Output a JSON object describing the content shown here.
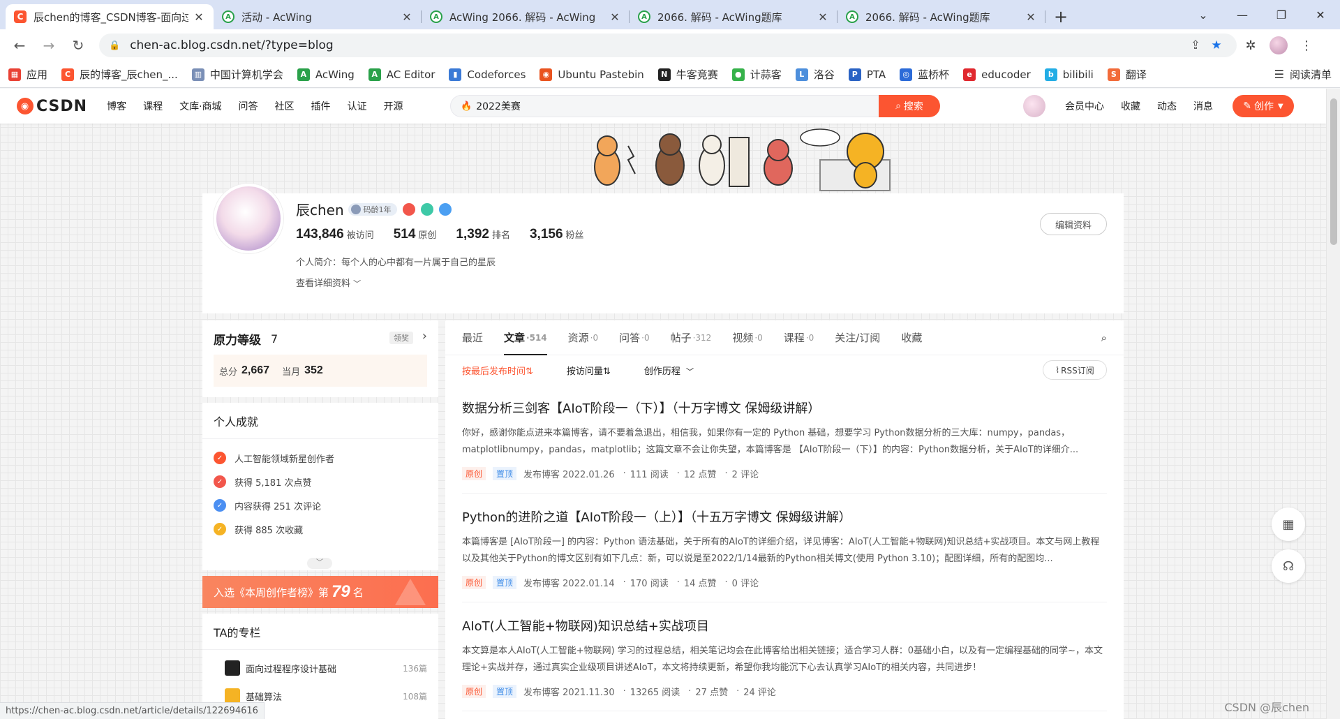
{
  "browser": {
    "tabs": [
      {
        "title": "辰chen的博客_CSDN博客-面向过程",
        "icon": "C",
        "active": true
      },
      {
        "title": "活动 - AcWing",
        "icon": "A",
        "active": false
      },
      {
        "title": "AcWing 2066. 解码 - AcWing",
        "icon": "A",
        "active": false
      },
      {
        "title": "2066. 解码 - AcWing题库",
        "icon": "A",
        "active": false
      },
      {
        "title": "2066. 解码 - AcWing题库",
        "icon": "A",
        "active": false
      }
    ],
    "url": "chen-ac.blog.csdn.net/?type=blog",
    "bookmarks": [
      {
        "label": "应用",
        "color": "#e94235",
        "glyph": "▦"
      },
      {
        "label": "辰的博客_辰chen_...",
        "color": "#fc5531",
        "glyph": "C"
      },
      {
        "label": "中国计算机学会",
        "color": "#7a8fb6",
        "glyph": "▥"
      },
      {
        "label": "AcWing",
        "color": "#2aa14a",
        "glyph": "A"
      },
      {
        "label": "AC Editor",
        "color": "#2aa14a",
        "glyph": "A"
      },
      {
        "label": "Codeforces",
        "color": "#3b7ad6",
        "glyph": "▮"
      },
      {
        "label": "Ubuntu Pastebin",
        "color": "#e95420",
        "glyph": "◉"
      },
      {
        "label": "牛客竞赛",
        "color": "#222222",
        "glyph": "N"
      },
      {
        "label": "计蒜客",
        "color": "#36b24a",
        "glyph": "●"
      },
      {
        "label": "洛谷",
        "color": "#4d8fdc",
        "glyph": "L"
      },
      {
        "label": "PTA",
        "color": "#2b63c4",
        "glyph": "P"
      },
      {
        "label": "蓝桥杯",
        "color": "#2c6bd8",
        "glyph": "◎"
      },
      {
        "label": "educoder",
        "color": "#e0282e",
        "glyph": "e"
      },
      {
        "label": "bilibili",
        "color": "#23ade5",
        "glyph": "b"
      },
      {
        "label": "翻译",
        "color": "#f26b3a",
        "glyph": "S"
      }
    ],
    "reading_list": "阅读清单",
    "status_url": "https://chen-ac.blog.csdn.net/article/details/122694616"
  },
  "csdn": {
    "logo": "CSDN",
    "nav": [
      "博客",
      "课程",
      "文库·商城",
      "问答",
      "社区",
      "插件",
      "认证",
      "开源"
    ],
    "search_placeholder": "2022美赛",
    "search_button": "搜索",
    "nav_right": [
      "会员中心",
      "收藏",
      "动态",
      "消息"
    ],
    "create_button": "创作"
  },
  "profile": {
    "name": "辰chen",
    "code_age": "码龄1年",
    "stats": [
      {
        "value": "143,846",
        "label": "被访问"
      },
      {
        "value": "514",
        "label": "原创"
      },
      {
        "value": "1,392",
        "label": "排名"
      },
      {
        "value": "3,156",
        "label": "粉丝"
      }
    ],
    "bio": "个人简介：每个人的心中都有一片属于自己的星辰",
    "more_info": "查看详细资料",
    "edit_button": "编辑资料"
  },
  "sidebar": {
    "level_title": "原力等级",
    "level_value": "7",
    "level_tag": "领奖",
    "total_label": "总分",
    "total_value": "2,667",
    "month_label": "当月",
    "month_value": "352",
    "achievements_title": "个人成就",
    "achievements": [
      {
        "text": "人工智能领域新星创作者",
        "color": "#fc5531"
      },
      {
        "text": "获得 5,181 次点赞",
        "color": "#f2564b"
      },
      {
        "text": "内容获得 251 次评论",
        "color": "#4b8ff2"
      },
      {
        "text": "获得 885 次收藏",
        "color": "#f5b324"
      }
    ],
    "rank_prefix": "入选《本周创作者榜》第",
    "rank_number": "79",
    "rank_suffix": "名",
    "columns_title": "TA的专栏",
    "columns": [
      {
        "name": "面向过程程序设计基础",
        "count": "136篇"
      },
      {
        "name": "基础算法",
        "count": "108篇"
      }
    ]
  },
  "main": {
    "tabs": [
      {
        "label": "最近",
        "count": ""
      },
      {
        "label": "文章",
        "count": "·514"
      },
      {
        "label": "资源",
        "count": "·0"
      },
      {
        "label": "问答",
        "count": "·0"
      },
      {
        "label": "帖子",
        "count": "·312"
      },
      {
        "label": "视频",
        "count": "·0"
      },
      {
        "label": "课程",
        "count": "·0"
      },
      {
        "label": "关注/订阅",
        "count": ""
      },
      {
        "label": "收藏",
        "count": ""
      }
    ],
    "sort_latest": "按最后发布时间⇅",
    "sort_views": "按访问量⇅",
    "history": "创作历程",
    "rss": "RSS订阅",
    "tag_original": "原创",
    "tag_top": "置顶",
    "articles": [
      {
        "title": "数据分析三剑客【AIoT阶段一（下）】（十万字博文 保姆级讲解）",
        "desc": "你好，感谢你能点进来本篇博客，请不要着急退出，相信我，如果你有一定的 Python 基础，想要学习 Python数据分析的三大库：numpy，pandas，matplotlibnumpy，pandas，matplotlib；这篇文章不会让你失望，本篇博客是 【AIoT阶段一（下）】的内容：Python数据分析，关于AIoT的详细介...",
        "date": "发布博客 2022.01.26",
        "views": "111 阅读",
        "likes": "12 点赞",
        "comments": "2 评论"
      },
      {
        "title": "Python的进阶之道【AIoT阶段一（上）】（十五万字博文 保姆级讲解）",
        "desc": "本篇博客是 [AIoT阶段一] 的内容：Python 语法基础，关于所有的AIoT的详细介绍，详见博客：AIoT(人工智能+物联网)知识总结+实战项目。本文与网上教程以及其他关于Python的博文区别有如下几点：新，可以说是至2022/1/14最新的Python相关博文(使用 Python 3.10)；配图详细，所有的配图均...",
        "date": "发布博客 2022.01.14",
        "views": "170 阅读",
        "likes": "14 点赞",
        "comments": "0 评论"
      },
      {
        "title": "AIoT(人工智能+物联网)知识总结+实战项目",
        "desc": "本文算是本人AIoT(人工智能+物联网) 学习的过程总结，相关笔记均会在此博客给出相关链接；适合学习人群：0基础小白，以及有一定编程基础的同学~，本文理论+实战并存，通过真实企业级项目讲述AIoT，本文将持续更新，希望你我均能沉下心去认真学习AIoT的相关内容，共同进步！",
        "date": "发布博客 2021.11.30",
        "views": "13265 阅读",
        "likes": "27 点赞",
        "comments": "24 评论"
      }
    ]
  },
  "watermark": "CSDN @辰chen"
}
